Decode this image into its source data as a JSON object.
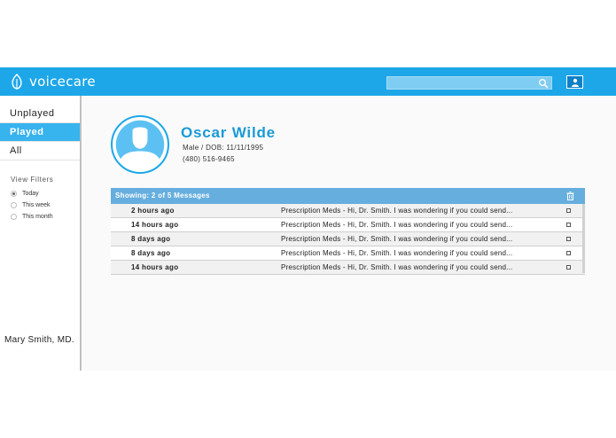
{
  "app": {
    "name": "voicecare"
  },
  "header": {
    "search_placeholder": ""
  },
  "sidebar": {
    "items": [
      {
        "label": "Unplayed",
        "active": false
      },
      {
        "label": "Played",
        "active": true
      },
      {
        "label": "All",
        "active": false
      }
    ],
    "filters_title": "View Filters",
    "filters": [
      {
        "label": "Today",
        "selected": true
      },
      {
        "label": "This week",
        "selected": false
      },
      {
        "label": "This month",
        "selected": false
      }
    ],
    "doctor": "Mary Smith, MD."
  },
  "patient": {
    "name": "Oscar Wilde",
    "details": "Male / DOB: 11/11/1995",
    "phone": "(480) 516-9465"
  },
  "messages": {
    "header": "Showing: 2 of 5 Messages",
    "rows": [
      {
        "time": "2 hours ago",
        "preview": "Prescription Meds - Hi, Dr. Smith. I was wondering if you could send..."
      },
      {
        "time": "14 hours ago",
        "preview": "Prescription Meds - Hi, Dr. Smith. I was wondering if you could send..."
      },
      {
        "time": "8 days ago",
        "preview": "Prescription Meds - Hi, Dr. Smith. I was wondering if you could send..."
      },
      {
        "time": "8 days ago",
        "preview": "Prescription Meds - Hi, Dr. Smith. I was wondering if you could send..."
      },
      {
        "time": "14 hours ago",
        "preview": "Prescription Meds - Hi, Dr. Smith. I was wondering if you could send..."
      }
    ]
  },
  "colors": {
    "brand": "#1ea7e8",
    "active_nav": "#37b3ee",
    "table_header": "#66aede",
    "patient_name": "#1a9ad6"
  },
  "icons": [
    "leaf-logo-icon",
    "search-icon",
    "user-icon",
    "trash-icon",
    "avatar-silhouette-icon"
  ]
}
